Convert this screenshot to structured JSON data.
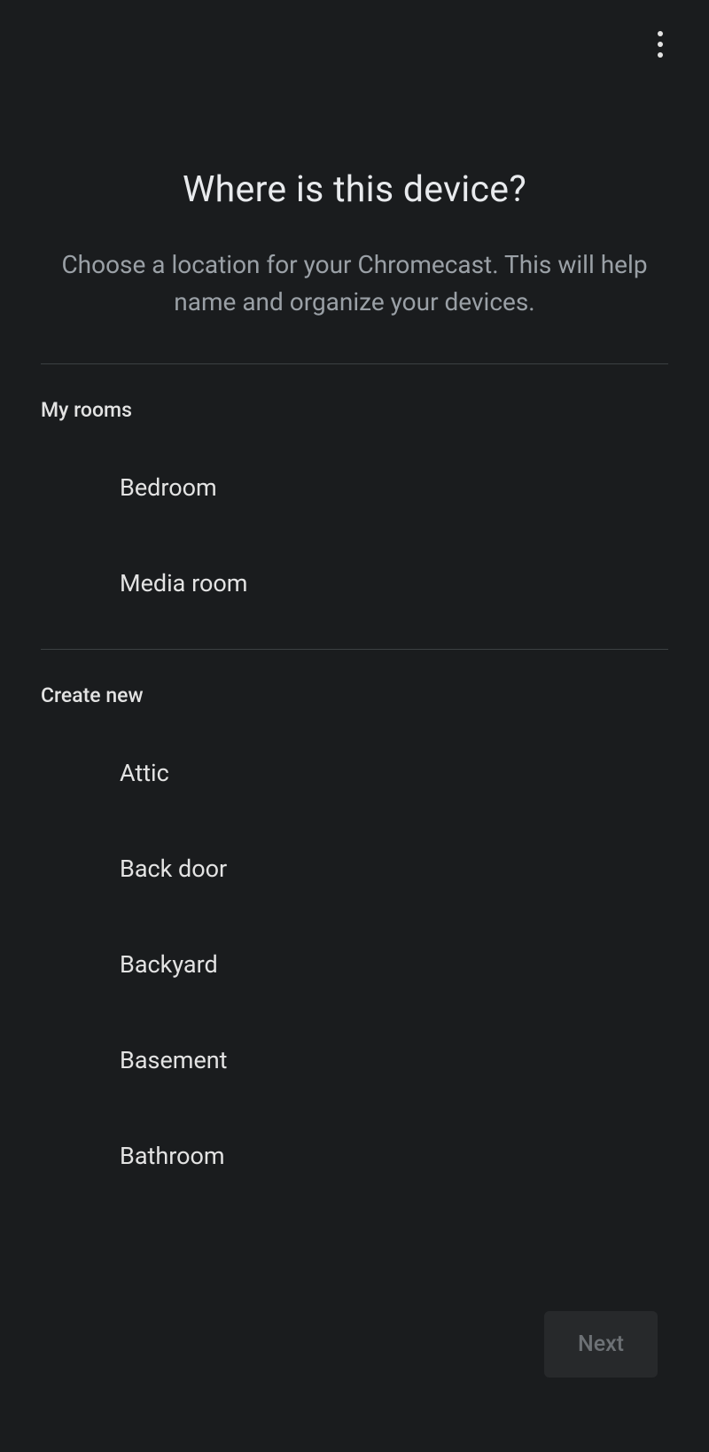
{
  "title": "Where is this device?",
  "subtitle": "Choose a location for your Chromecast. This will help name and organize your devices.",
  "sections": {
    "myRooms": {
      "header": "My rooms",
      "items": [
        "Bedroom",
        "Media room"
      ]
    },
    "createNew": {
      "header": "Create new",
      "items": [
        "Attic",
        "Back door",
        "Backyard",
        "Basement",
        "Bathroom"
      ]
    }
  },
  "nextButton": "Next"
}
